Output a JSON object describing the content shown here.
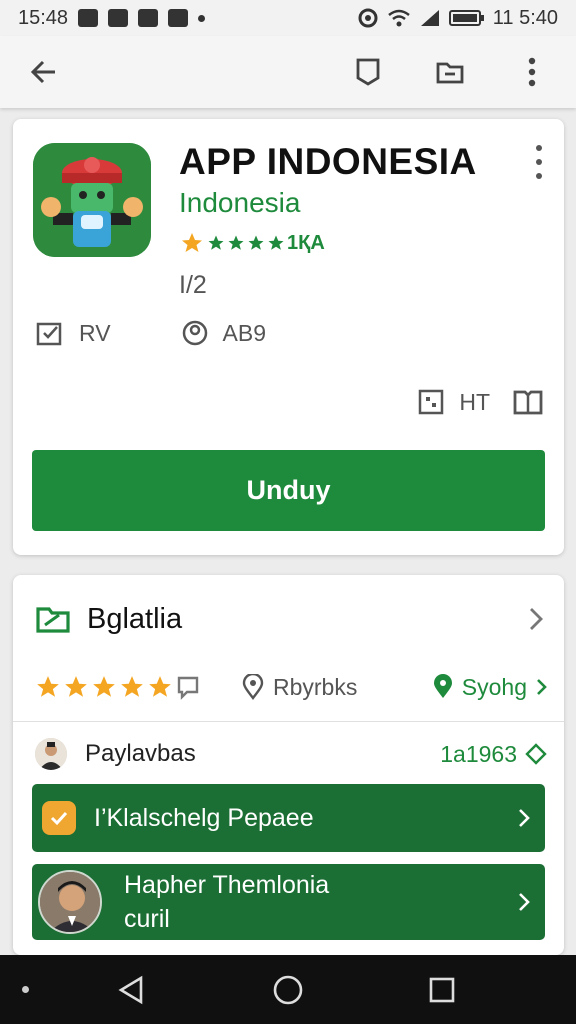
{
  "status_bar": {
    "time_left": "15:48",
    "time_right": "11 5:40"
  },
  "app": {
    "title": "APP INDONESIA",
    "developer": "Indonesia",
    "rating_text": "1ҚA",
    "version": "I/2",
    "meta": [
      {
        "icon": "checkbox-icon",
        "label": "RV"
      },
      {
        "icon": "account-circle-icon",
        "label": "AB9"
      }
    ],
    "side_label": "HT",
    "install_label": "Unduy"
  },
  "detail": {
    "section_title": "Bglatlia",
    "star_count": 5,
    "middle_label": "Rbyrbks",
    "right_label": "Syohg",
    "review": {
      "name": "Paylavbas",
      "count": "1a1963"
    },
    "rows": [
      {
        "label": "I’Klalschelg Pepaee"
      },
      {
        "label": "Hapher Themlonia",
        "sub": "curil"
      }
    ]
  },
  "colors": {
    "accent": "#1e8a3c",
    "row_green": "#1b6e34",
    "star": "#f4a623"
  }
}
